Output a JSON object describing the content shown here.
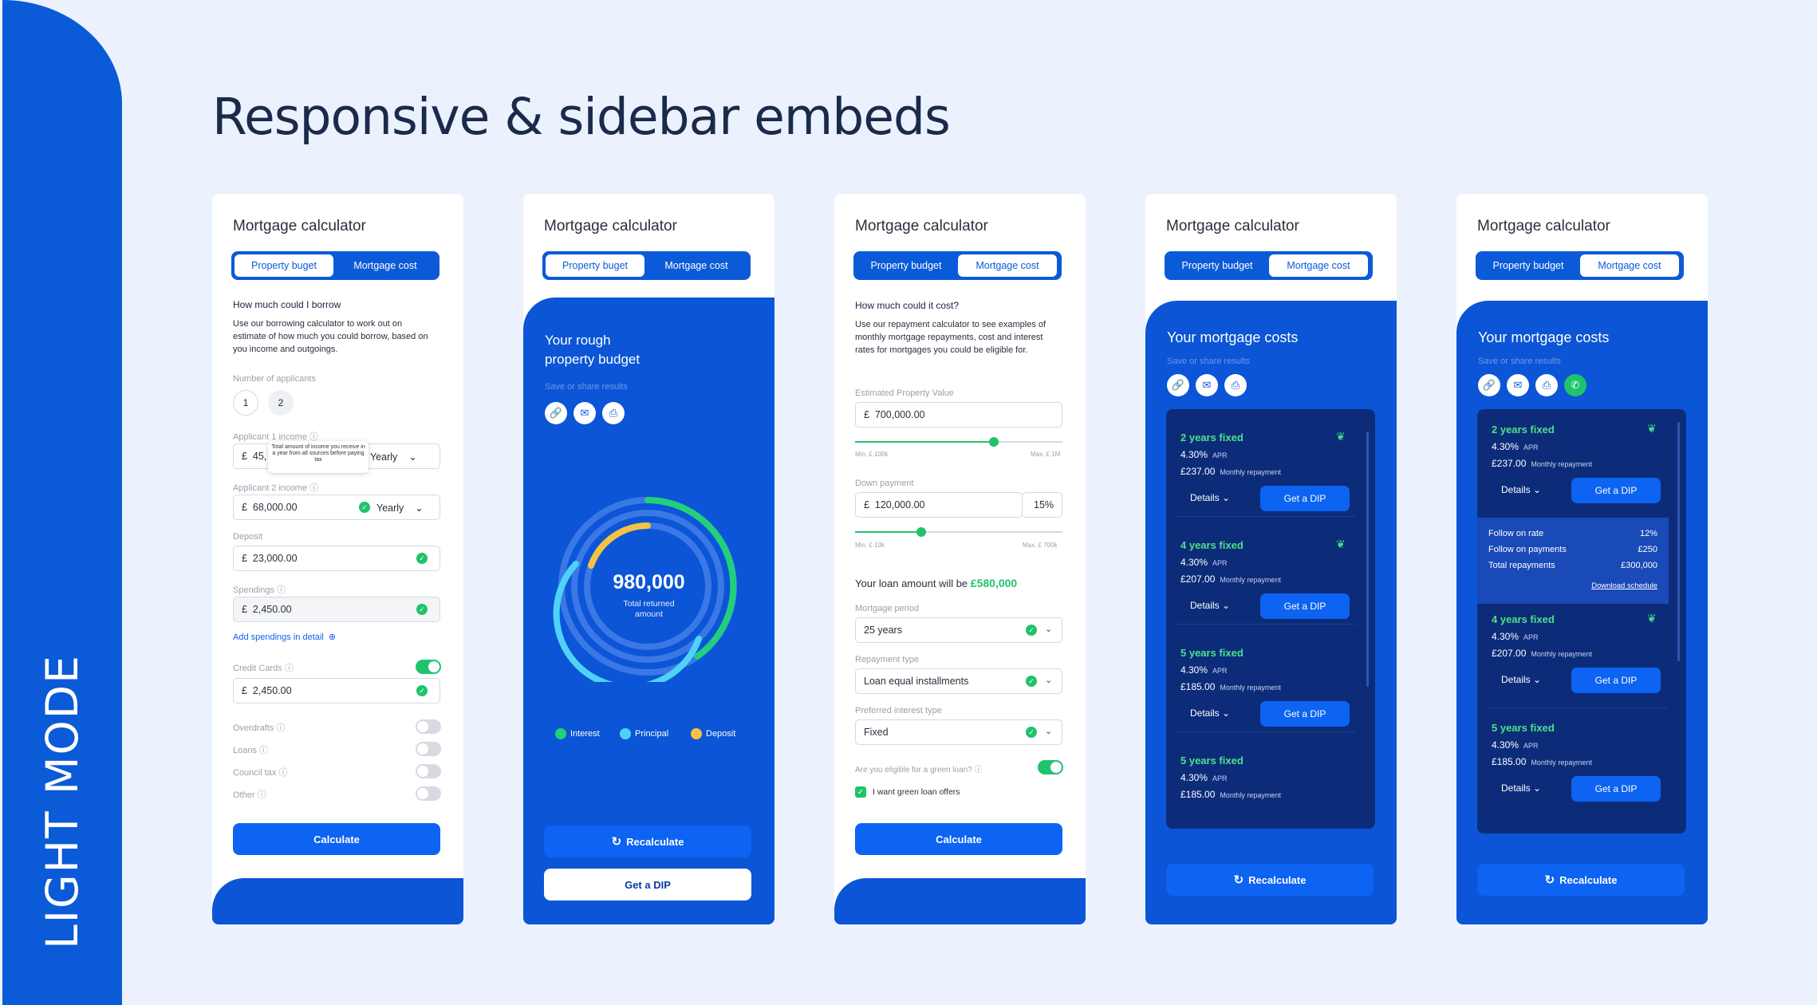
{
  "side_label": "LIGHT MODE",
  "headline": "Responsive & sidebar embeds",
  "card_title": "Mortgage calculator",
  "tabs": {
    "budget_typo": "Property buget",
    "budget": "Property budget",
    "cost": "Mortgage cost"
  },
  "colors": {
    "brand_blue": "#0b5ad8",
    "dark_panel": "#0c2c7a",
    "green": "#1fc36b",
    "yellow": "#f5c242",
    "cyan": "#4fd2f7"
  },
  "c1": {
    "heading": "How much could I borrow",
    "desc": "Use our borrowing calculator to work out on estimate of how much you could borrow, based on you income and outgoings.",
    "applicants_label": "Number of applicants",
    "applicants": [
      "1",
      "2"
    ],
    "app1_label": "Applicant 1 income",
    "app1_value": "45,",
    "tooltip": "Total amount of income you receive in a year from all sources before paying tax",
    "freq": "Yearly",
    "app2_label": "Applicant 2 income",
    "app2_value": "68,000.00",
    "deposit_label": "Deposit",
    "deposit_value": "23,000.00",
    "spendings_label": "Spendings",
    "spendings_value": "2,450.00",
    "add_spendings": "Add spendings in detail",
    "credit_label": "Credit Cards",
    "credit_value": "2,450.00",
    "toggles": [
      "Overdrafts",
      "Loans",
      "Council tax",
      "Other"
    ],
    "calculate": "Calculate",
    "currency": "£"
  },
  "c2": {
    "title_line1": "Your rough",
    "title_line2": "property budget",
    "save_share": "Save or share results",
    "amount": "980,000",
    "amount_label_1": "Total returned",
    "amount_label_2": "amount",
    "legend": [
      "Interest",
      "Principal",
      "Deposit"
    ],
    "recalculate": "Recalculate",
    "get_dip": "Get a DIP"
  },
  "c3": {
    "heading": "How much could it cost?",
    "desc": "Use our repayment calculator to see examples of monthly mortgage repayments, cost and interest rates for mortgages you could be eligible for.",
    "epv_label": "Estimated Property Value",
    "epv_value": "700,000.00",
    "epv_min": "Min. £ 100k",
    "epv_max": "Max. £ 1M",
    "epv_slider_fraction": 0.67,
    "dp_label": "Down payment",
    "dp_value": "120,000.00",
    "dp_pct": "15%",
    "dp_min": "Min. £ 10k",
    "dp_max": "Max. £ 700k",
    "dp_slider_fraction": 0.32,
    "loan_text": "Your loan amount will be",
    "loan_amount": "£580,000",
    "period_label": "Mortgage period",
    "period_value": "25 years",
    "repay_label": "Repayment type",
    "repay_value": "Loan equal installments",
    "rate_label": "Preferred interest type",
    "rate_value": "Fixed",
    "green_q": "Are you eligible for a green loan?",
    "green_offers": "I want green loan offers",
    "calculate": "Calculate"
  },
  "costs_title": "Your mortgage costs",
  "save_share": "Save or share results",
  "c4_offers": [
    {
      "title": "2 years fixed",
      "apr": "4.30%",
      "monthly": "£237.00",
      "green": true
    },
    {
      "title": "4 years fixed",
      "apr": "4.30%",
      "monthly": "£207.00",
      "green": true
    },
    {
      "title": "5 years fixed",
      "apr": "4.30%",
      "monthly": "£185.00",
      "green": false
    },
    {
      "title": "5 years fixed",
      "apr": "4.30%",
      "monthly": "£185.00",
      "green": false
    }
  ],
  "apr_label": "APR",
  "monthly_label": "Monthly repayment",
  "details": "Details",
  "get_dip": "Get a DIP",
  "recalculate": "Recalculate",
  "c5_detail": {
    "follow_rate_label": "Follow on rate",
    "follow_rate": "12%",
    "follow_pay_label": "Follow on payments",
    "follow_pay": "£250",
    "total_label": "Total repayments",
    "total": "£300,000",
    "download": "Download schedule"
  },
  "c5_offers": [
    {
      "title": "2 years fixed",
      "apr": "4.30%",
      "monthly": "£237.00",
      "green": true
    },
    {
      "title": "4 years fixed",
      "apr": "4.30%",
      "monthly": "£207.00",
      "green": true
    },
    {
      "title": "5 years fixed",
      "apr": "4.30%",
      "monthly": "£185.00",
      "green": false
    }
  ]
}
